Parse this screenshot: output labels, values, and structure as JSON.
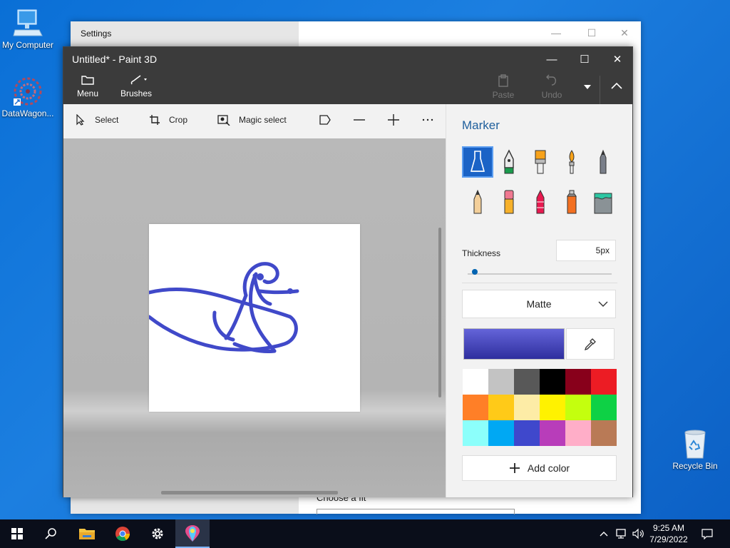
{
  "desktop": {
    "icons": [
      {
        "label": "My Computer"
      },
      {
        "label": "DataWagon..."
      },
      {
        "label": "Recycle Bin"
      }
    ]
  },
  "settings": {
    "title": "Settings",
    "peek_text": "Choose a fit"
  },
  "paint": {
    "title": "Untitled* - Paint 3D",
    "toolbar": {
      "menu": "Menu",
      "brushes": "Brushes",
      "paste": "Paste",
      "undo": "Undo"
    },
    "tools": {
      "select": "Select",
      "crop": "Crop",
      "magic_select": "Magic select"
    },
    "panel": {
      "title": "Marker",
      "brushes": [
        "marker",
        "calligraphy-pen",
        "oil-brush",
        "watercolor",
        "pixel-pen",
        "pencil",
        "eraser",
        "crayon",
        "spray-can",
        "fill"
      ],
      "thickness_label": "Thickness",
      "thickness_value": "5px",
      "thickness_level": 0.05,
      "finish": "Matte",
      "current_color": "#4a4ad0",
      "palette": [
        "#ffffff",
        "#c3c3c3",
        "#585858",
        "#000000",
        "#88001b",
        "#ec1c24",
        "#ff7f27",
        "#ffca18",
        "#fdeca6",
        "#fff200",
        "#c4ff0e",
        "#0ed145",
        "#8cfffb",
        "#00a8f3",
        "#3f48cc",
        "#b83dba",
        "#ffaec8",
        "#b97a56"
      ],
      "add_color": "Add color"
    }
  },
  "taskbar": {
    "time": "9:25 AM",
    "date": "7/29/2022"
  },
  "colors": {
    "stroke": "#3f48cc",
    "accent": "#1b63c6"
  }
}
